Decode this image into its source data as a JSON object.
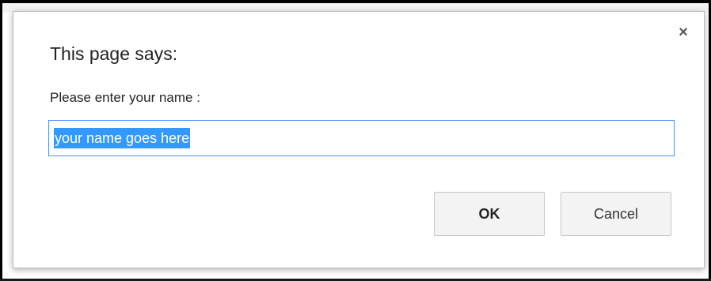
{
  "dialog": {
    "title": "This page says:",
    "message": "Please enter your name :",
    "input_value": "your name goes here",
    "close_glyph": "×",
    "ok_label": "OK",
    "cancel_label": "Cancel"
  },
  "colors": {
    "selection": "#3399ff",
    "input_focus_border": "#4d90fe",
    "button_bg": "#f3f3f3"
  },
  "icons": {
    "close": "close-icon"
  }
}
